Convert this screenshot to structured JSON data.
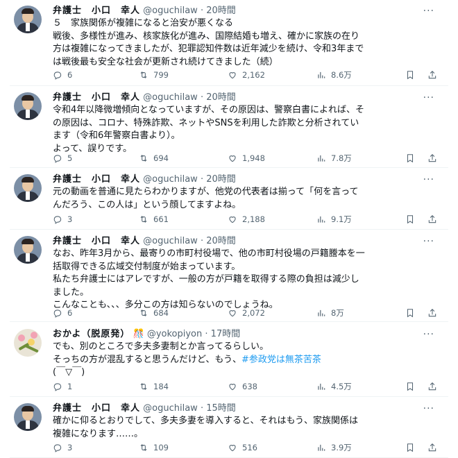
{
  "tweets": [
    {
      "name": "弁護士　小口　幸人",
      "handle": "@oguchilaw",
      "time": "20時間",
      "lines": [
        "５　家族関係が複雑になると治安が悪くなる",
        "戦後、多様性が進み、核家族化が進み、国際結婚も増え、確かに家族の在り",
        "方は複雑になってきましたが、犯罪認知件数は近年減少を続け、令和3年まで",
        "は戦後最も安全な社会が更新され続けてきました（続）"
      ],
      "replies": "6",
      "retweets": "799",
      "likes": "2,162",
      "views": "8.6万"
    },
    {
      "name": "弁護士　小口　幸人",
      "handle": "@oguchilaw",
      "time": "20時間",
      "lines": [
        "令和4年以降微増傾向となっていますが、その原因は、警察白書によれば、そ",
        "の原因は、コロナ、特殊詐欺、ネットやSNSを利用した詐欺と分析されてい",
        "ます（令和6年警察白書より）。",
        "よって、誤りです。"
      ],
      "replies": "5",
      "retweets": "694",
      "likes": "1,948",
      "views": "7.8万"
    },
    {
      "name": "弁護士　小口　幸人",
      "handle": "@oguchilaw",
      "time": "20時間",
      "lines": [
        "元の動画を普通に見たらわかりますが、他党の代表者は揃って「何を言って",
        "んだろう、この人は」という顔してますよね。"
      ],
      "replies": "3",
      "retweets": "661",
      "likes": "2,188",
      "views": "9.1万"
    },
    {
      "name": "弁護士　小口　幸人",
      "handle": "@oguchilaw",
      "time": "20時間",
      "lines": [
        "なお、昨年3月から、最寄りの市町村役場で、他の市町村役場の戸籍謄本を一",
        "括取得できる広域交付制度が始まっています。",
        "私たち弁護士にはアレですが、一般の方が戸籍を取得する際の負担は減少し",
        "ました。",
        "こんなことも、、、多分この方は知らないのでしょうね。"
      ],
      "replies": "6",
      "retweets": "684",
      "likes": "2,072",
      "views": "8万"
    },
    {
      "name": "おかよ（脱原発）",
      "emoji": "🎊",
      "handle": "@yokopiyon",
      "time": "17時間",
      "lines": [
        "でも、別のところで多夫多妻制とか言ってるらしい。",
        "そっちの方が混乱すると思うんだけど、もう、",
        "(￣▽￣)"
      ],
      "hashtag": "#参政党は無茶苦茶",
      "replies": "1",
      "retweets": "184",
      "likes": "638",
      "views": "4.5万"
    },
    {
      "name": "弁護士　小口　幸人",
      "handle": "@oguchilaw",
      "time": "15時間",
      "lines": [
        "確かに仰るとおりでして、多夫多妻を導入すると、それはもう、家族関係は",
        "複雑になります……。"
      ],
      "replies": "3",
      "retweets": "109",
      "likes": "516",
      "views": "3.9万"
    }
  ],
  "separator": "·",
  "more_label": "···",
  "colors": {
    "text": "#0f1419",
    "muted": "#536471",
    "link": "#1d9bf0",
    "divider": "#eff3f4"
  },
  "icons": [
    "reply-icon",
    "retweet-icon",
    "like-icon",
    "views-icon",
    "bookmark-icon",
    "share-icon"
  ]
}
